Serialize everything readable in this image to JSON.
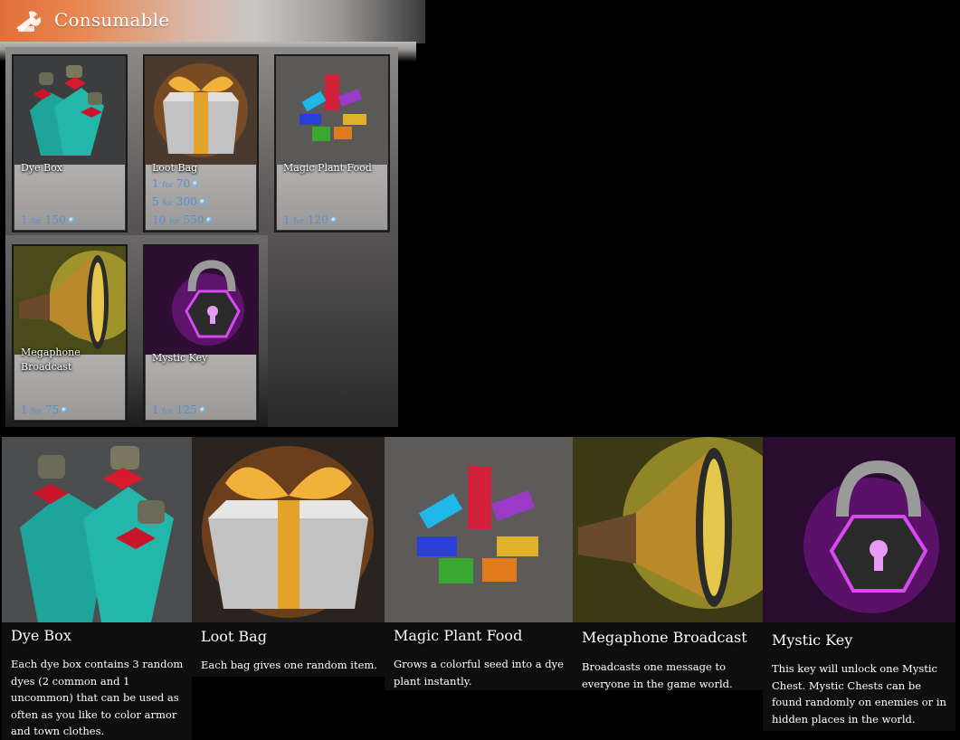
{
  "header": {
    "title": "Consumable",
    "icon": "tools-icon"
  },
  "items": [
    {
      "name": "Dye Box",
      "prices": [
        {
          "qty": "1",
          "for": "for",
          "cost": "150"
        }
      ]
    },
    {
      "name": "Loot Bag",
      "prices": [
        {
          "qty": "1",
          "for": "for",
          "cost": "70"
        },
        {
          "qty": "5",
          "for": "for",
          "cost": "300"
        },
        {
          "qty": "10",
          "for": "for",
          "cost": "550"
        }
      ]
    },
    {
      "name": "Magic Plant Food",
      "prices": [
        {
          "qty": "1",
          "for": "for",
          "cost": "120"
        }
      ]
    },
    {
      "name": "Megaphone Broadcast",
      "prices": [
        {
          "qty": "1",
          "for": "for",
          "cost": "75"
        }
      ]
    },
    {
      "name": "Mystic Key",
      "prices": [
        {
          "qty": "1",
          "for": "for",
          "cost": "125"
        }
      ]
    }
  ],
  "details": [
    {
      "title": "Dye Box",
      "desc": "Each dye box contains 3 random dyes (2 common and 1 uncommon) that can be used as often as you like to color armor and town clothes."
    },
    {
      "title": "Loot Bag",
      "desc": "Each bag gives one random item."
    },
    {
      "title": "Magic Plant Food",
      "desc": "Grows a colorful seed into a dye plant instantly."
    },
    {
      "title": "Megaphone Broadcast",
      "desc": "Broadcasts one message to everyone in the game world."
    },
    {
      "title": "Mystic Key",
      "desc": "This key will unlock one Mystic Chest. Mystic Chests can be found randomly on enemies or in hidden places in the world."
    }
  ],
  "colors": {
    "accent": "#e0703a",
    "price": "#4f8fd6"
  }
}
